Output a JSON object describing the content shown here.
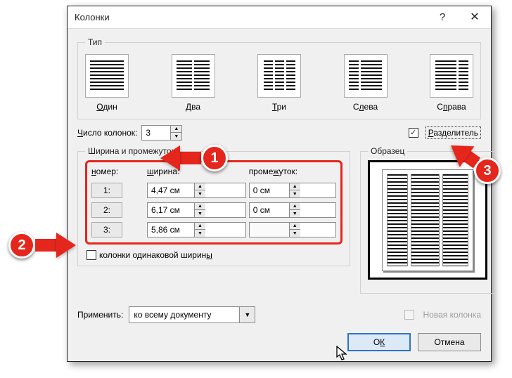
{
  "dialog": {
    "title": "Колонки",
    "help": "?",
    "close": "✕"
  },
  "type_group": {
    "legend": "Тип",
    "presets": {
      "one": "Один",
      "two": "Два",
      "three": "Три",
      "left": "Слева",
      "right": "Справа"
    }
  },
  "count": {
    "label": "Число колонок:",
    "underline": "Ч",
    "value": "3"
  },
  "separator": {
    "label": "Разделитель",
    "underline": "Р",
    "checked": true
  },
  "width_group": {
    "legend": "Ширина и промежуток",
    "headers": {
      "num": "номер:",
      "width": "ширина:",
      "gap": "промежуток:"
    },
    "rows": [
      {
        "num": "1:",
        "width": "4,47 см",
        "gap": "0 см"
      },
      {
        "num": "2:",
        "width": "6,17 см",
        "gap": "0 см"
      },
      {
        "num": "3:",
        "width": "5,86 см",
        "gap": ""
      }
    ],
    "equal_label": "колонки одинаковой ширины",
    "equal_underline": "ы",
    "equal_checked": false
  },
  "preview": {
    "legend": "Образец"
  },
  "apply": {
    "label": "Применить:",
    "value": "ко всему документу"
  },
  "new_column": {
    "label": "Новая колонка",
    "enabled": false
  },
  "buttons": {
    "ok": "ОК",
    "cancel": "Отмена"
  },
  "annotations": {
    "n1": "1",
    "n2": "2",
    "n3": "3"
  }
}
